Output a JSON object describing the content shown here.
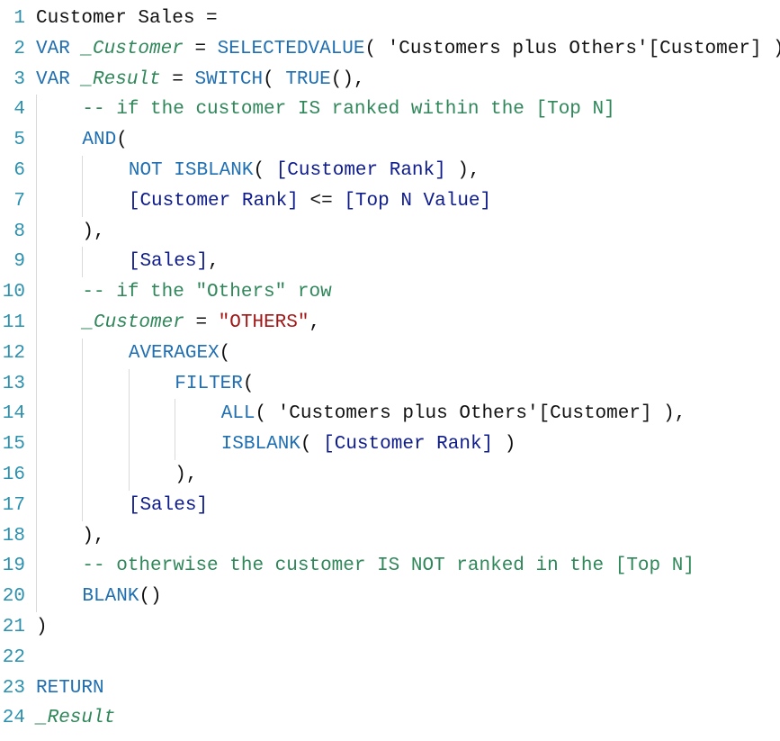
{
  "language": "DAX",
  "measure_name": "Customer Sales",
  "line_count": 24,
  "colors": {
    "line_number": "#2b91af",
    "keyword": "#1f6fb2",
    "function": "#1f6fb2",
    "variable": "#2f875a",
    "measure_ref": "#0d1b8c",
    "comment": "#2f875a",
    "string": "#a31515",
    "indent_guide": "#d9d9d9",
    "plain": "#111111"
  },
  "lines": [
    {
      "n": 1,
      "indent": 0,
      "tokens": [
        {
          "t": "Customer Sales ",
          "c": "plain"
        },
        {
          "t": "=",
          "c": "op"
        }
      ]
    },
    {
      "n": 2,
      "indent": 0,
      "tokens": [
        {
          "t": "VAR",
          "c": "keyword"
        },
        {
          "t": " ",
          "c": "plain"
        },
        {
          "t": "_Customer",
          "c": "varname"
        },
        {
          "t": " ",
          "c": "plain"
        },
        {
          "t": "=",
          "c": "op"
        },
        {
          "t": " ",
          "c": "plain"
        },
        {
          "t": "SELECTEDVALUE",
          "c": "func"
        },
        {
          "t": "( 'Customers plus Others'[Customer] )",
          "c": "plain"
        }
      ]
    },
    {
      "n": 3,
      "indent": 0,
      "tokens": [
        {
          "t": "VAR",
          "c": "keyword"
        },
        {
          "t": " ",
          "c": "plain"
        },
        {
          "t": "_Result",
          "c": "varname"
        },
        {
          "t": " ",
          "c": "plain"
        },
        {
          "t": "=",
          "c": "op"
        },
        {
          "t": " ",
          "c": "plain"
        },
        {
          "t": "SWITCH",
          "c": "func"
        },
        {
          "t": "( ",
          "c": "plain"
        },
        {
          "t": "TRUE",
          "c": "func"
        },
        {
          "t": "(),",
          "c": "plain"
        }
      ]
    },
    {
      "n": 4,
      "indent": 1,
      "tokens": [
        {
          "t": "-- if the customer IS ranked within the [Top N]",
          "c": "comment"
        }
      ]
    },
    {
      "n": 5,
      "indent": 1,
      "tokens": [
        {
          "t": "AND",
          "c": "func"
        },
        {
          "t": "(",
          "c": "plain"
        }
      ]
    },
    {
      "n": 6,
      "indent": 2,
      "tokens": [
        {
          "t": "NOT",
          "c": "keyword"
        },
        {
          "t": " ",
          "c": "plain"
        },
        {
          "t": "ISBLANK",
          "c": "func"
        },
        {
          "t": "( ",
          "c": "plain"
        },
        {
          "t": "[Customer Rank]",
          "c": "measure"
        },
        {
          "t": " ),",
          "c": "plain"
        }
      ]
    },
    {
      "n": 7,
      "indent": 2,
      "tokens": [
        {
          "t": "[Customer Rank]",
          "c": "measure"
        },
        {
          "t": " ",
          "c": "plain"
        },
        {
          "t": "<=",
          "c": "op"
        },
        {
          "t": " ",
          "c": "plain"
        },
        {
          "t": "[Top N Value]",
          "c": "measure"
        }
      ]
    },
    {
      "n": 8,
      "indent": 1,
      "tokens": [
        {
          "t": "),",
          "c": "plain"
        }
      ]
    },
    {
      "n": 9,
      "indent": 2,
      "tokens": [
        {
          "t": "[Sales]",
          "c": "measure"
        },
        {
          "t": ",",
          "c": "plain"
        }
      ]
    },
    {
      "n": 10,
      "indent": 1,
      "tokens": [
        {
          "t": "-- if the \"Others\" row",
          "c": "comment"
        }
      ]
    },
    {
      "n": 11,
      "indent": 1,
      "tokens": [
        {
          "t": "_Customer",
          "c": "varname"
        },
        {
          "t": " ",
          "c": "plain"
        },
        {
          "t": "=",
          "c": "op"
        },
        {
          "t": " ",
          "c": "plain"
        },
        {
          "t": "\"OTHERS\"",
          "c": "string"
        },
        {
          "t": ",",
          "c": "plain"
        }
      ]
    },
    {
      "n": 12,
      "indent": 2,
      "tokens": [
        {
          "t": "AVERAGEX",
          "c": "func"
        },
        {
          "t": "(",
          "c": "plain"
        }
      ]
    },
    {
      "n": 13,
      "indent": 3,
      "tokens": [
        {
          "t": "FILTER",
          "c": "func"
        },
        {
          "t": "(",
          "c": "plain"
        }
      ]
    },
    {
      "n": 14,
      "indent": 4,
      "tokens": [
        {
          "t": "ALL",
          "c": "func"
        },
        {
          "t": "( 'Customers plus Others'[Customer] ),",
          "c": "plain"
        }
      ]
    },
    {
      "n": 15,
      "indent": 4,
      "tokens": [
        {
          "t": "ISBLANK",
          "c": "func"
        },
        {
          "t": "( ",
          "c": "plain"
        },
        {
          "t": "[Customer Rank]",
          "c": "measure"
        },
        {
          "t": " )",
          "c": "plain"
        }
      ]
    },
    {
      "n": 16,
      "indent": 3,
      "tokens": [
        {
          "t": "),",
          "c": "plain"
        }
      ]
    },
    {
      "n": 17,
      "indent": 2,
      "tokens": [
        {
          "t": "[Sales]",
          "c": "measure"
        }
      ]
    },
    {
      "n": 18,
      "indent": 1,
      "tokens": [
        {
          "t": "),",
          "c": "plain"
        }
      ]
    },
    {
      "n": 19,
      "indent": 1,
      "tokens": [
        {
          "t": "-- otherwise the customer IS NOT ranked in the [Top N]",
          "c": "comment"
        }
      ]
    },
    {
      "n": 20,
      "indent": 1,
      "tokens": [
        {
          "t": "BLANK",
          "c": "func"
        },
        {
          "t": "()",
          "c": "plain"
        }
      ]
    },
    {
      "n": 21,
      "indent": 0,
      "tokens": [
        {
          "t": ")",
          "c": "plain"
        }
      ]
    },
    {
      "n": 22,
      "indent": 0,
      "tokens": []
    },
    {
      "n": 23,
      "indent": 0,
      "tokens": [
        {
          "t": "RETURN",
          "c": "keyword"
        }
      ]
    },
    {
      "n": 24,
      "indent": 0,
      "tokens": [
        {
          "t": "_Result",
          "c": "varname"
        }
      ]
    }
  ]
}
